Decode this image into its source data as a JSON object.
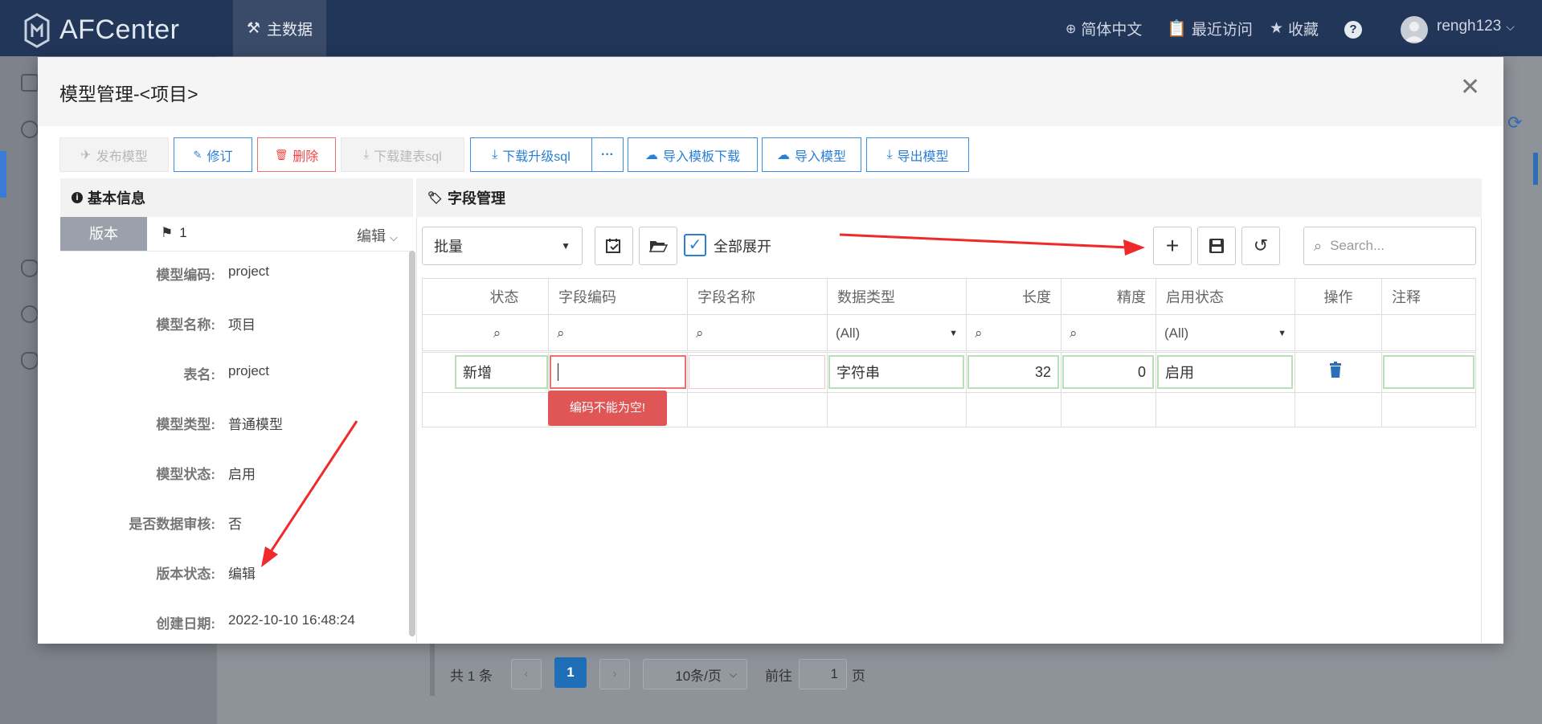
{
  "app": {
    "logo": "AFCenter",
    "nav_active": "主数据",
    "lang": "简体中文",
    "recent": "最近访问",
    "favorites": "收藏",
    "help": "?",
    "user": "rengh123"
  },
  "background": {
    "pagination": {
      "total": "共 1 条",
      "current": "1",
      "page_size": "10条/页",
      "goto_prefix": "前往",
      "goto_value": "1",
      "goto_suffix": "页"
    }
  },
  "modal": {
    "title": "模型管理-<项目>",
    "toolbar": {
      "publish": "发布模型",
      "revise": "修订",
      "delete": "删除",
      "download_create_sql": "下载建表sql",
      "download_upgrade_sql": "下载升级sql",
      "more": "···",
      "import_template": "导入模板下载",
      "import_model": "导入模型",
      "export_model": "导出模型"
    },
    "basic_info": {
      "title": "基本信息",
      "tab": "版本",
      "version": "1",
      "edit": "编辑",
      "fields": [
        {
          "label": "模型编码:",
          "value": "project"
        },
        {
          "label": "模型名称:",
          "value": "项目"
        },
        {
          "label": "表名:",
          "value": "project"
        },
        {
          "label": "模型类型:",
          "value": "普通模型"
        },
        {
          "label": "模型状态:",
          "value": "启用"
        },
        {
          "label": "是否数据审核:",
          "value": "否"
        },
        {
          "label": "版本状态:",
          "value": "编辑"
        },
        {
          "label": "创建日期:",
          "value": "2022-10-10 16:48:24"
        }
      ]
    },
    "field_mgmt": {
      "title": "字段管理",
      "batch_select": "批量",
      "expand_all": "全部展开",
      "search_placeholder": "Search...",
      "columns": [
        "状态",
        "字段编码",
        "字段名称",
        "数据类型",
        "长度",
        "精度",
        "启用状态",
        "操作",
        "注释"
      ],
      "filter_all": "(All)",
      "row": {
        "status": "新增",
        "code": "",
        "name": "",
        "type": "字符串",
        "length": "32",
        "precision": "0",
        "enabled": "启用",
        "remark": ""
      },
      "error_tip": "编码不能为空!"
    }
  },
  "colors": {
    "navbar": "#22365a",
    "primary": "#2a7fd4",
    "danger": "#e44444",
    "valid_border": "#b7e0b7"
  }
}
